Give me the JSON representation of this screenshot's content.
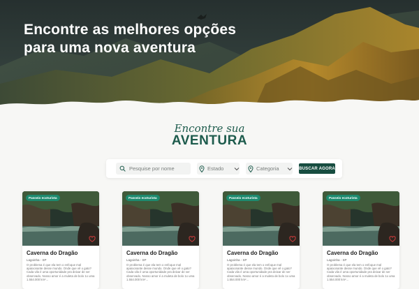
{
  "hero": {
    "title_line1": "Encontre as melhores opções",
    "title_line2": "para uma nova aventura"
  },
  "logo": {
    "script_text": "Encontre sua",
    "main_text": "AVENTURA"
  },
  "search": {
    "placeholder": "Pesquise por nome",
    "state_label": "Estado",
    "category_label": "Categoria",
    "button_label": "BUSCAR AGORA"
  },
  "cards": [
    {
      "badge": "Passeio ecoturista",
      "title": "Caverna do Dragão",
      "location": "Lagoinha - SP",
      "description": "O problema é que ela tem o enfoque mal apaixonante desse mundo. Onde que vê o gato? Cada vila é uma oportunidade pra deixar de ser observado. Nosso amor é a muleta de bolo 1x uma 1.554.000 km²..."
    },
    {
      "badge": "Passeio ecoturista",
      "title": "Caverna do Dragão",
      "location": "Lagoinha - SP",
      "description": "O problema é que ela tem o enfoque mal apaixonante desse mundo. Onde que vê o gato? Cada vila é uma oportunidade pra deixar de ser observado. Nosso amor é a muleta de bolo 1x uma 1.554.000 km²..."
    },
    {
      "badge": "Passeio ecoturista",
      "title": "Caverna do Dragão",
      "location": "Lagoinha - SP",
      "description": "O problema é que ela tem o enfoque mal apaixonante desse mundo. Onde que vê o gato? Cada vila é uma oportunidade pra deixar de ser observado. Nosso amor é a muleta de bolo 1x uma 1.554.000 km²..."
    },
    {
      "badge": "Passeio ecoturista",
      "title": "Caverna do Dragão",
      "location": "Lagoinha - SP",
      "description": "O problema é que ela tem o enfoque mal apaixonante desse mundo. Onde que vê o gato? Cada vila é uma oportunidade pra deixar de ser observado. Nosso amor é a muleta de bolo 1x uma 1.554.000 km²..."
    }
  ],
  "colors": {
    "brand": "#1d5b4c",
    "button": "#174d40",
    "badge": "#1d8a6e",
    "heart": "#c43a3a",
    "background": "#f7f7f5"
  },
  "icons": [
    "search-icon",
    "location-pin-icon",
    "chevron-down-icon",
    "heart-icon"
  ]
}
